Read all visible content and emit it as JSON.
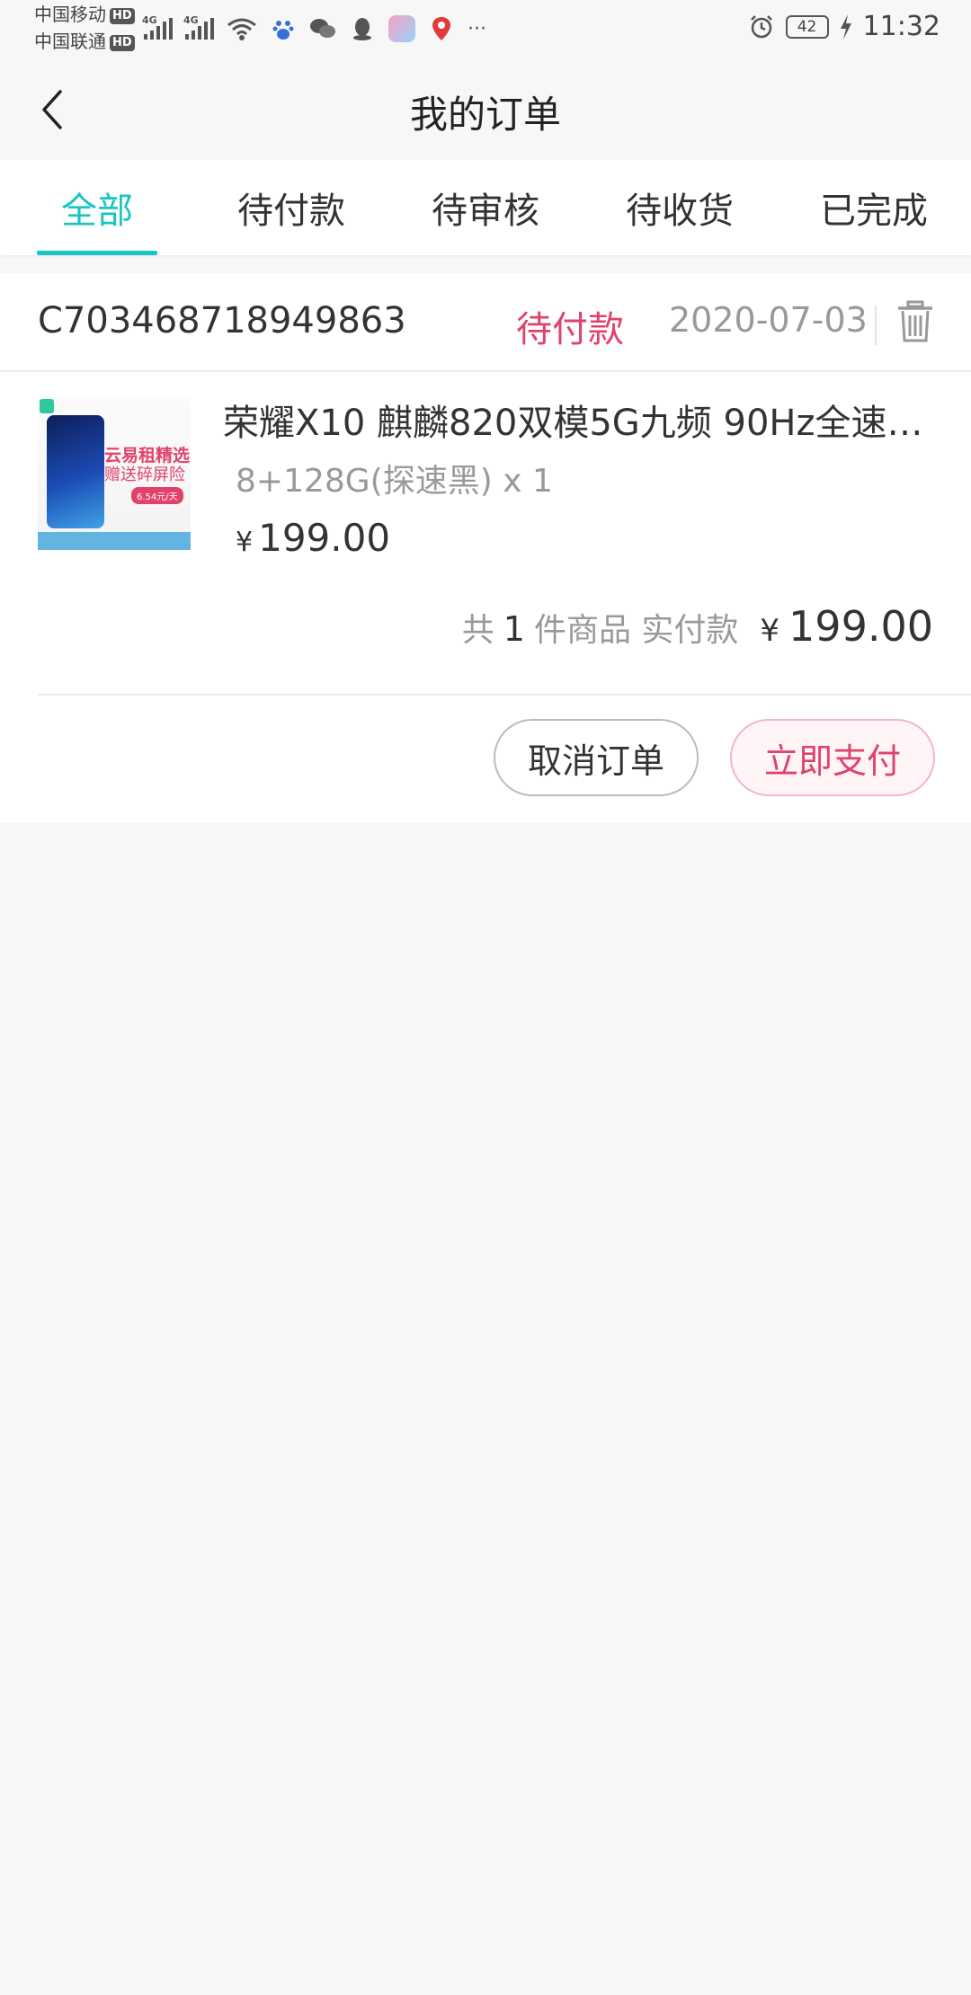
{
  "status_bar": {
    "carrier_1": "中国移动",
    "carrier_2": "中国联通",
    "hd_badge": "HD",
    "network_type": "4G",
    "battery": "42",
    "time": "11:32",
    "more": "···"
  },
  "header": {
    "title": "我的订单"
  },
  "tabs": [
    {
      "label": "全部",
      "active": true
    },
    {
      "label": "待付款",
      "active": false
    },
    {
      "label": "待审核",
      "active": false
    },
    {
      "label": "待收货",
      "active": false
    },
    {
      "label": "已完成",
      "active": false
    }
  ],
  "order": {
    "number": "C703468718949863",
    "status": "待付款",
    "date": "2020-07-03",
    "product": {
      "thumbnail_text_1": "云易租精选",
      "thumbnail_text_2": "赠送碎屏险",
      "thumbnail_text_3": "6.54元/天",
      "name": "荣耀X10 麒麟820双模5G九频 90Hz全速…",
      "spec": "8+128G(探速黑) x 1",
      "currency": "¥",
      "price": "199.00"
    },
    "summary": {
      "prefix": "共",
      "count": "1",
      "suffix": "件商品 实付款",
      "currency": "¥",
      "amount": "199.00"
    },
    "actions": {
      "cancel": "取消订单",
      "pay": "立即支付"
    }
  },
  "colors": {
    "accent": "#1ac4c4",
    "status_pink": "#e0426b",
    "background": "#f7f7f7"
  }
}
